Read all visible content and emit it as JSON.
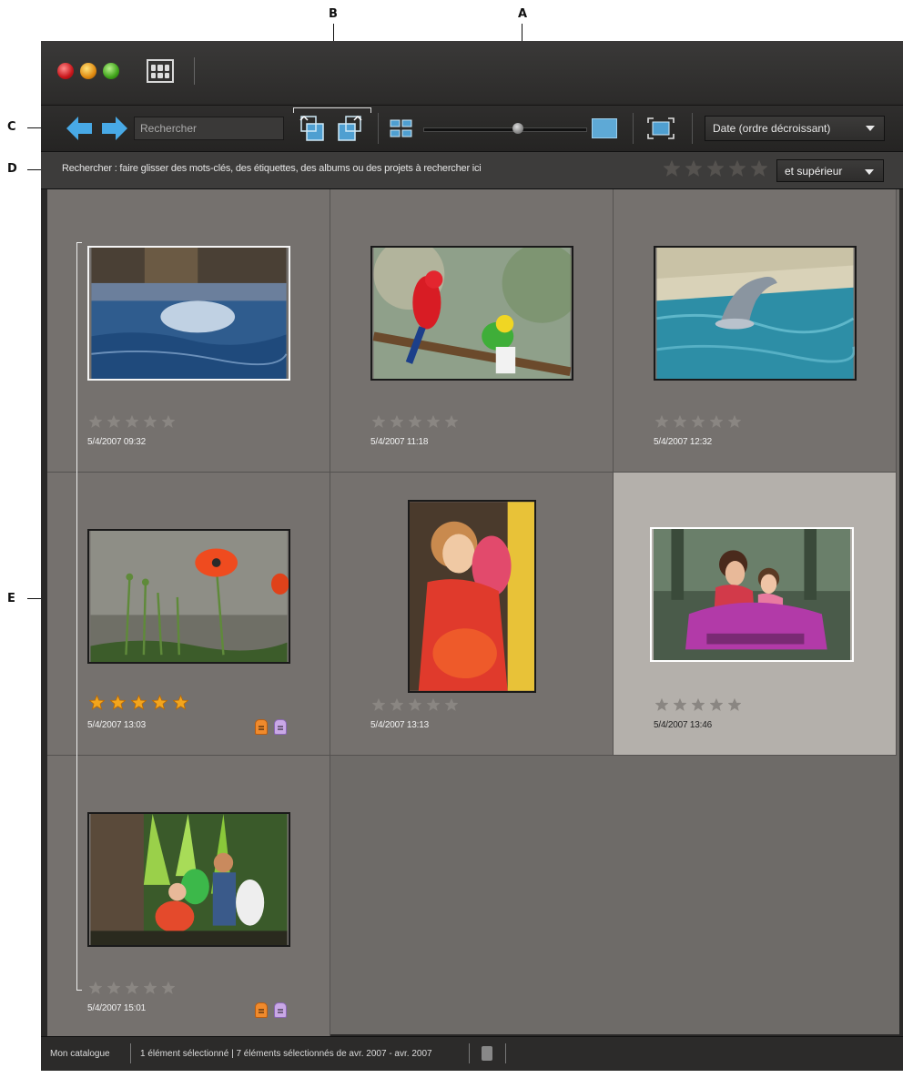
{
  "callouts": [
    "A",
    "B",
    "C",
    "D",
    "E"
  ],
  "toolbar": {
    "search_placeholder": "Rechercher",
    "sort_value": "Date  (ordre décroissant)",
    "slider_fraction": 0.58
  },
  "search_bar": {
    "hint": "Rechercher : faire glisser des mots-clés, des étiquettes, des albums ou des projets à rechercher ici",
    "rating_value": "et supérieur"
  },
  "photos": [
    {
      "date": "5/4/2007 09:32",
      "rating": 0,
      "tags": []
    },
    {
      "date": "5/4/2007 11:18",
      "rating": 0,
      "tags": []
    },
    {
      "date": "5/4/2007 12:32",
      "rating": 0,
      "tags": []
    },
    {
      "date": "5/4/2007 13:03",
      "rating": 5,
      "tags": [
        "orange",
        "purple"
      ]
    },
    {
      "date": "5/4/2007 13:13",
      "rating": 0,
      "tags": []
    },
    {
      "date": "5/4/2007 13:46",
      "rating": 0,
      "tags": [],
      "selected": true
    },
    {
      "date": "5/4/2007 15:01",
      "rating": 0,
      "tags": [
        "orange",
        "purple"
      ]
    }
  ],
  "status": {
    "catalog": "Mon catalogue",
    "selected": "1 élément sélectionné  |  7 éléments sélectionnés  de avr. 2007 - avr. 2007"
  }
}
